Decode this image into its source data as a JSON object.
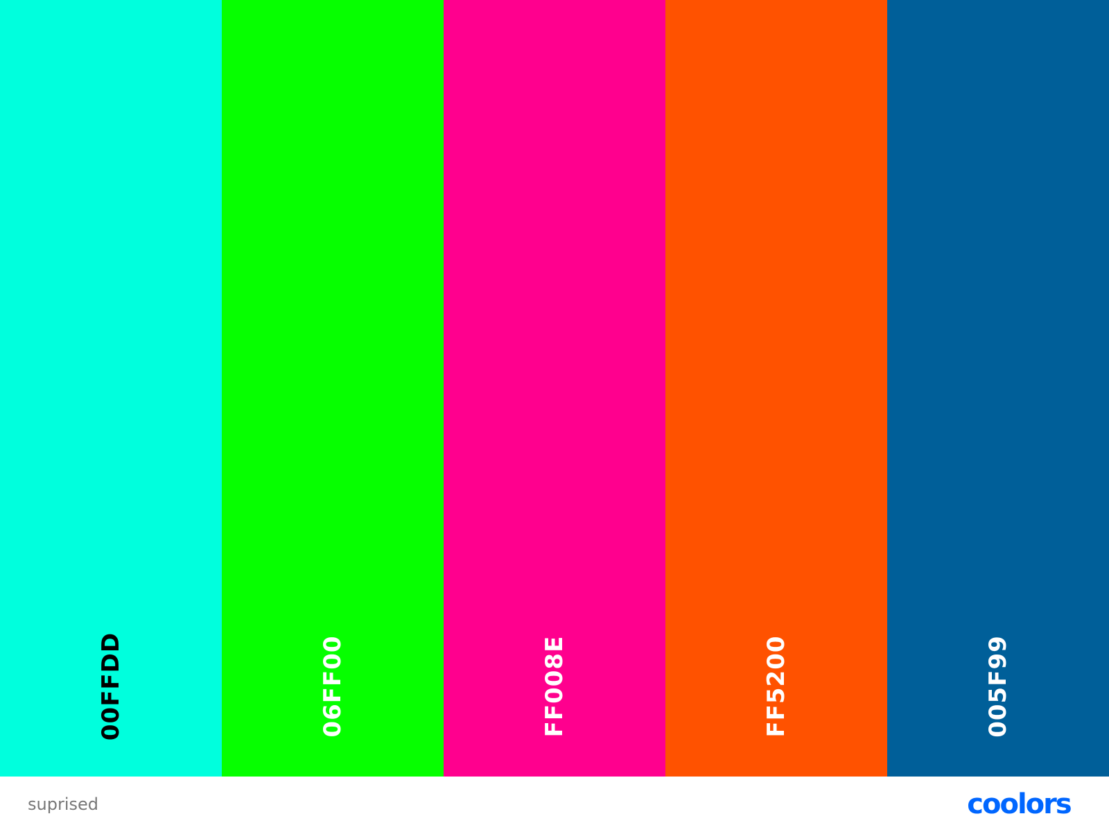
{
  "swatches": [
    {
      "hex": "00FFDD",
      "color": "#00FFDD",
      "text_color": "#000000"
    },
    {
      "hex": "06FF00",
      "color": "#06FF00",
      "text_color": "#FFFFFF"
    },
    {
      "hex": "FF008E",
      "color": "#FF008E",
      "text_color": "#FFFFFF"
    },
    {
      "hex": "FF5200",
      "color": "#FF5200",
      "text_color": "#FFFFFF"
    },
    {
      "hex": "005F99",
      "color": "#005F99",
      "text_color": "#FFFFFF"
    }
  ],
  "footer": {
    "palette_name": "suprised",
    "brand": "coolors",
    "brand_color": "#0066FF"
  }
}
